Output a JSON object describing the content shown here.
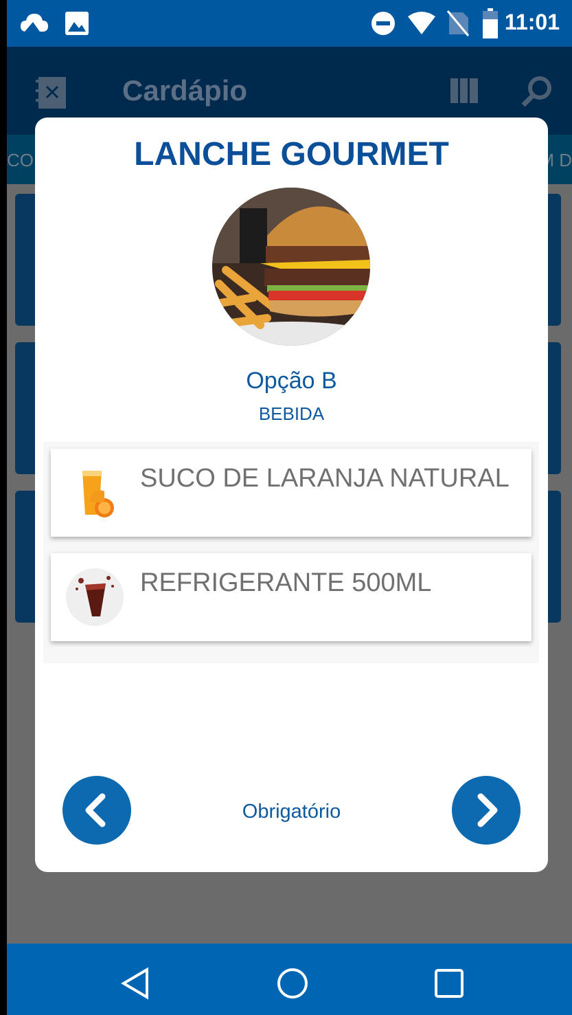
{
  "status_bar": {
    "time": "11:01"
  },
  "app_bar": {
    "title": "Cardápio"
  },
  "tabs": {
    "left_partial": "CO",
    "right_partial": "M D"
  },
  "dialog": {
    "title": "LANCHE GOURMET",
    "option_name": "Opção B",
    "option_category": "BEBIDA",
    "items": [
      {
        "label": "SUCO DE LARANJA NATURAL",
        "icon": "orange-juice-icon"
      },
      {
        "label": "REFRIGERANTE 500ML",
        "icon": "soda-glass-icon"
      }
    ],
    "footer_label": "Obrigatório"
  },
  "colors": {
    "primary": "#0066b3",
    "title": "#0a4f98",
    "status": "#0059a0"
  }
}
